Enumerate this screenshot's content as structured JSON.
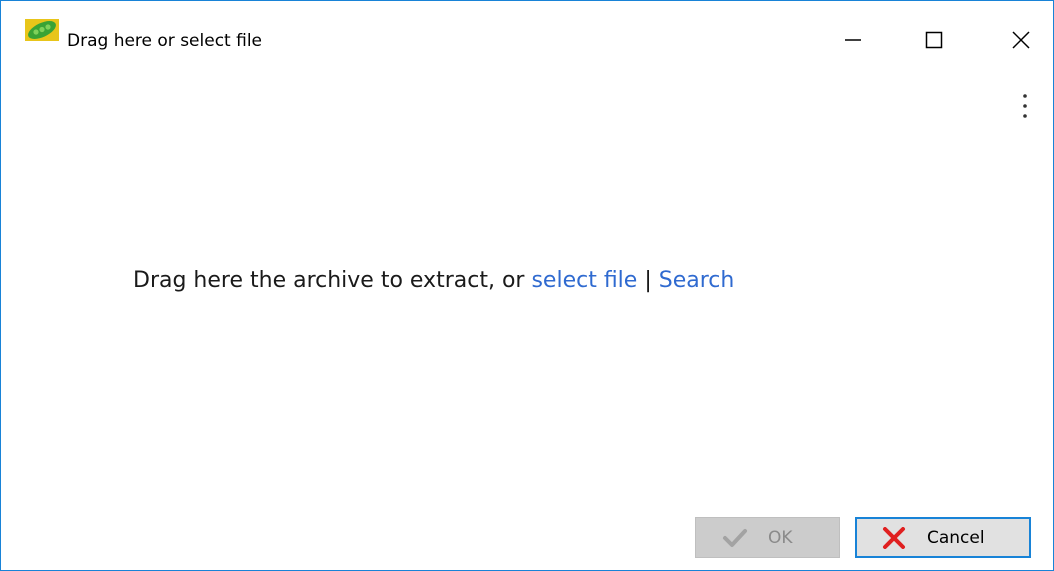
{
  "window": {
    "title": "Drag here or select file",
    "app_icon": "pea-pod-icon",
    "controls": {
      "minimize": "minimize-icon",
      "maximize": "maximize-icon",
      "close": "close-icon"
    },
    "menu_icon": "kebab-menu-icon"
  },
  "main": {
    "message_prefix": "Drag here the archive to extract, or ",
    "select_file_link": "select file",
    "separator": " | ",
    "search_link": "Search"
  },
  "buttons": {
    "ok_label": "OK",
    "ok_enabled": false,
    "cancel_label": "Cancel"
  },
  "colors": {
    "accent_border": "#1883d7",
    "link": "#2f6ad0",
    "cancel_x": "#e02020",
    "ok_disabled_bg": "#cccccc"
  }
}
